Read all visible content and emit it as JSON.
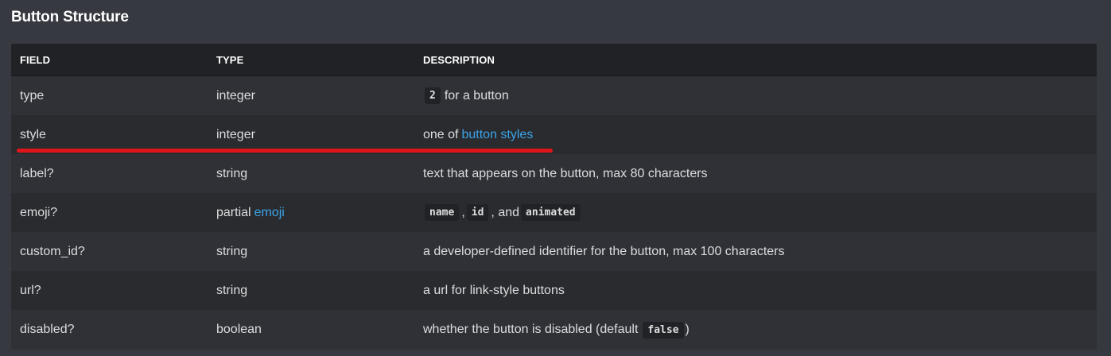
{
  "section": {
    "title": "Button Structure"
  },
  "headers": {
    "field": "FIELD",
    "type": "TYPE",
    "description": "DESCRIPTION"
  },
  "rows": [
    {
      "field": "type",
      "type": "integer",
      "desc_code": "2",
      "desc_text": "for a button"
    },
    {
      "field": "style",
      "type": "integer",
      "desc_prefix": "one of",
      "desc_link": "button styles"
    },
    {
      "field": "label?",
      "type": "string",
      "desc": "text that appears on the button, max 80 characters"
    },
    {
      "field": "emoji?",
      "type_prefix": "partial",
      "type_link": "emoji",
      "desc_code1": "name",
      "desc_sep1": ",",
      "desc_code2": "id",
      "desc_sep2": ", and",
      "desc_code3": "animated"
    },
    {
      "field": "custom_id?",
      "type": "string",
      "desc": "a developer-defined identifier for the button, max 100 characters"
    },
    {
      "field": "url?",
      "type": "string",
      "desc": "a url for link-style buttons"
    },
    {
      "field": "disabled?",
      "type": "boolean",
      "desc_prefix": "whether the button is disabled (default",
      "desc_code": "false",
      "desc_suffix": ")"
    }
  ],
  "annotation": {
    "underline_color": "#e0151b"
  },
  "colors": {
    "background": "#36393f",
    "table_bg": "#2f3136",
    "row_alt": "#292b2f",
    "header_bg": "#202225",
    "link": "#3ba3e8"
  }
}
